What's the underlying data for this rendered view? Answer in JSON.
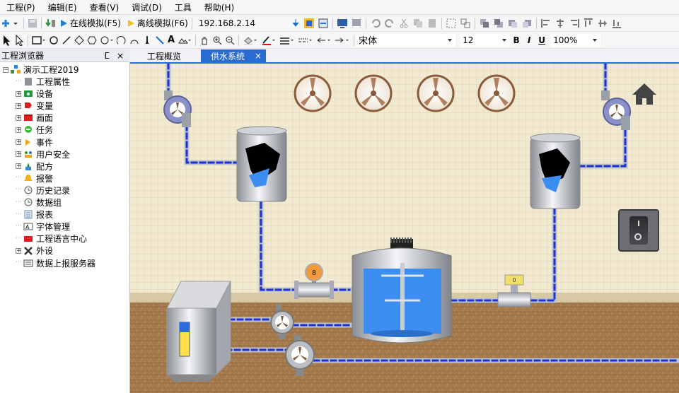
{
  "menu": [
    "工程(P)",
    "编辑(E)",
    "查看(V)",
    "调试(D)",
    "工具",
    "帮助(H)"
  ],
  "toolbar": {
    "online_sim": "在线模拟(F5)",
    "offline_sim": "离线模拟(F6)",
    "ip": "192.168.2.14",
    "font_name": "宋体",
    "font_size": "12",
    "bold": "B",
    "italic": "I",
    "underline": "U",
    "zoom": "100%"
  },
  "panel": {
    "title": "工程浏览器",
    "pin": "ᴾ",
    "close": "×"
  },
  "tree": {
    "root": "演示工程2019",
    "items": [
      "工程属性",
      "设备",
      "变量",
      "画面",
      "任务",
      "事件",
      "用户安全",
      "配方",
      "报警",
      "历史记录",
      "数据组",
      "报表",
      "字体管理",
      "工程语言中心",
      "外设",
      "数据上报服务器"
    ]
  },
  "tabs": {
    "overview": "工程概览",
    "water": "供水系统",
    "close": "×"
  },
  "gauge_values": {
    "pressure": "8",
    "flow": "0"
  },
  "colors": {
    "accent": "#2b6cd3",
    "pipe_flow": "#1a2fd6",
    "water": "#3b8ef0",
    "floor": "#a37a4f"
  }
}
